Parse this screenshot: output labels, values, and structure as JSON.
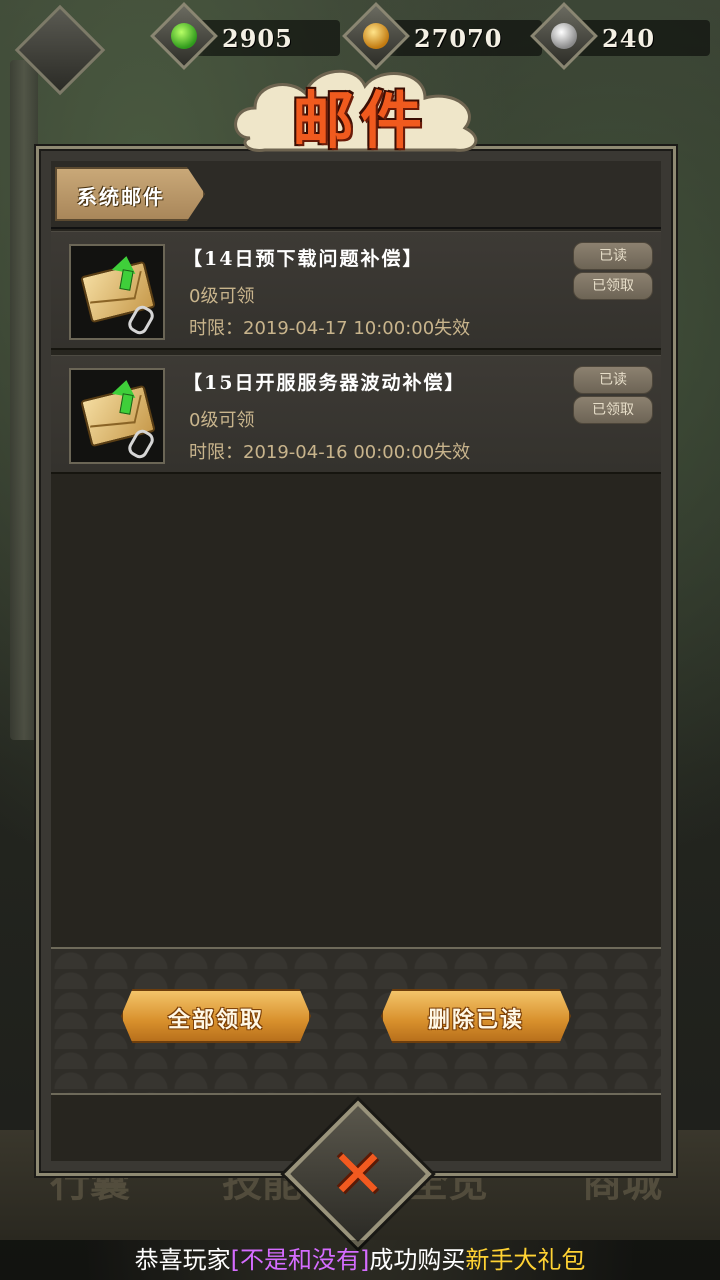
{
  "resources": [
    {
      "icon": "green-gem-icon",
      "value": "2905"
    },
    {
      "icon": "gold-coin-icon",
      "value": "27070"
    },
    {
      "icon": "silver-coin-icon",
      "value": "240"
    }
  ],
  "window": {
    "title": "邮件"
  },
  "tabs": [
    {
      "label": "系统邮件"
    }
  ],
  "mails": [
    {
      "title": "【14日预下载问题补偿】",
      "level": "0级可领",
      "expiry": "时限：2019-04-17  10:00:00失效",
      "read_badge": "已读",
      "claimed_badge": "已领取"
    },
    {
      "title": "【15日开服服务器波动补偿】",
      "level": "0级可领",
      "expiry": "时限：2019-04-16  00:00:00失效",
      "read_badge": "已读",
      "claimed_badge": "已领取"
    }
  ],
  "buttons": {
    "claim_all": "全部领取",
    "delete_read": "删除已读"
  },
  "bottom_nav": [
    "行囊",
    "技能",
    "全览",
    "商城"
  ],
  "marquee": {
    "prefix": "恭喜玩家",
    "player": "[不是和没有]",
    "middle": "成功购买",
    "item": "新手大礼包"
  },
  "colors": {
    "title": "#f05a1e",
    "close": "#f25a20",
    "player": "#d56cff",
    "item": "#ffd233"
  }
}
